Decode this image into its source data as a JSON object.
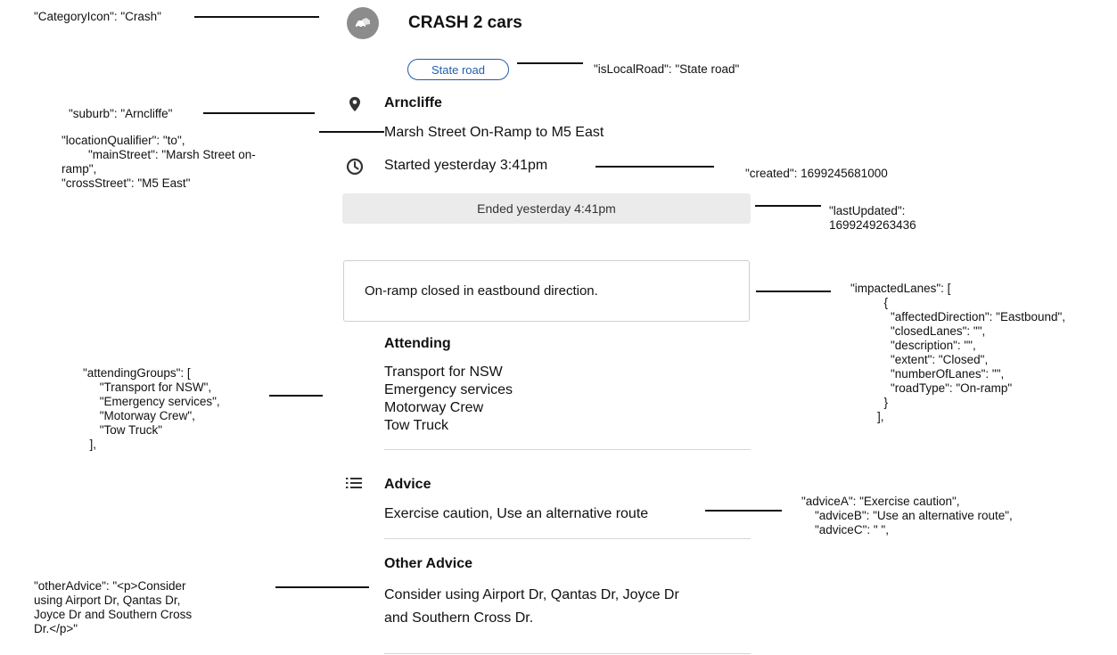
{
  "incident": {
    "title": "CRASH 2 cars",
    "road_type_badge": "State road",
    "suburb": "Arncliffe",
    "location": "Marsh Street On-Ramp to M5 East",
    "started": "Started yesterday 3:41pm",
    "ended": "Ended yesterday 4:41pm",
    "lane_impact": "On-ramp closed in eastbound direction.",
    "attending_heading": "Attending",
    "attending": [
      "Transport for NSW",
      "Emergency services",
      "Motorway Crew",
      "Tow Truck"
    ],
    "advice_heading": "Advice",
    "advice": "Exercise caution, Use an alternative route",
    "other_advice_heading": "Other Advice",
    "other_advice_line1": "Consider using Airport Dr, Qantas Dr, Joyce Dr",
    "other_advice_line2": "and Southern Cross Dr."
  },
  "annotations": {
    "category_icon": "\"CategoryIcon\": \"Crash\"",
    "is_local_road": "\"isLocalRoad\": \"State road\"",
    "suburb": "\"suburb\": \"Arncliffe\"",
    "location": "\"locationQualifier\": \"to\",\n        \"mainStreet\": \"Marsh Street on-\nramp\",\n\"crossStreet\": \"M5 East\"",
    "created": "\"created\": 1699245681000",
    "last_updated": "\"lastUpdated\":\n1699249263436",
    "impacted_lanes": "\"impactedLanes\": [\n          {\n            \"affectedDirection\": \"Eastbound\",\n            \"closedLanes\": \"\",\n            \"description\": \"\",\n            \"extent\": \"Closed\",\n            \"numberOfLanes\": \"\",\n            \"roadType\": \"On-ramp\"\n          }\n        ],",
    "attending_groups": "\"attendingGroups\": [\n     \"Transport for NSW\",\n     \"Emergency services\",\n     \"Motorway Crew\",\n     \"Tow Truck\"\n  ],",
    "advice": "\"adviceA\": \"Exercise caution\",\n    \"adviceB\": \"Use an alternative route\",\n    \"adviceC\": \" \",",
    "other_advice": "\"otherAdvice\": \"<p>Consider\nusing Airport Dr, Qantas Dr,\nJoyce Dr and Southern Cross\nDr.</p>\""
  },
  "icons": {
    "category": "crash-icon",
    "location": "map-pin-icon",
    "time": "clock-icon",
    "advice": "list-icon"
  },
  "colors": {
    "badge_blue": "#1e5fa8",
    "category_grey": "#8c8c8c",
    "ended_bg": "#ebebeb"
  }
}
